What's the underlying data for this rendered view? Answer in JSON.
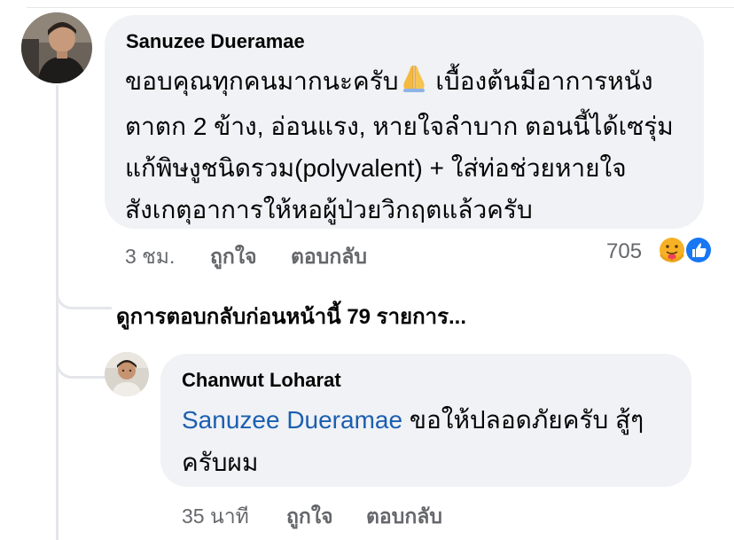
{
  "comment": {
    "author": "Sanuzee Dueramae",
    "lines": [
      "ขอบคุณทุกคนมากนะครับ",
      " เบื้องต้นมีอาการหนัง",
      "ตาตก 2 ข้าง, อ่อนแรง, หายใจลำบาก ตอนนี้ได้เซรุ่ม",
      "แก้พิษงูชนิดรวม(polyvalent) + ใส่ท่อช่วยหายใจ",
      "สังเกตุอาการให้หอผู้ป่วยวิกฤตแล้วครับ"
    ],
    "emoji_icon": "folded-hands-icon",
    "time": "3 ชม.",
    "like_label": "ถูกใจ",
    "reply_label": "ตอบกลับ",
    "reaction_count": "705",
    "reaction_icons": [
      "care-icon",
      "like-icon"
    ],
    "colors": {
      "like": "#1877f2",
      "care": "#f7b125"
    }
  },
  "more_replies_label": "ดูการตอบกลับก่อนหน้านี้ 79 รายการ...",
  "reply": {
    "author": "Chanwut Loharat",
    "mention": "Sanuzee Dueramae",
    "text_after_mention": " ขอให้ปลอดภัยครับ สู้ๆ",
    "line2": "ครับผม",
    "time": "35 นาที",
    "like_label": "ถูกใจ",
    "reply_label": "ตอบกลับ",
    "colors": {
      "mention": "#1b5fb0"
    }
  }
}
